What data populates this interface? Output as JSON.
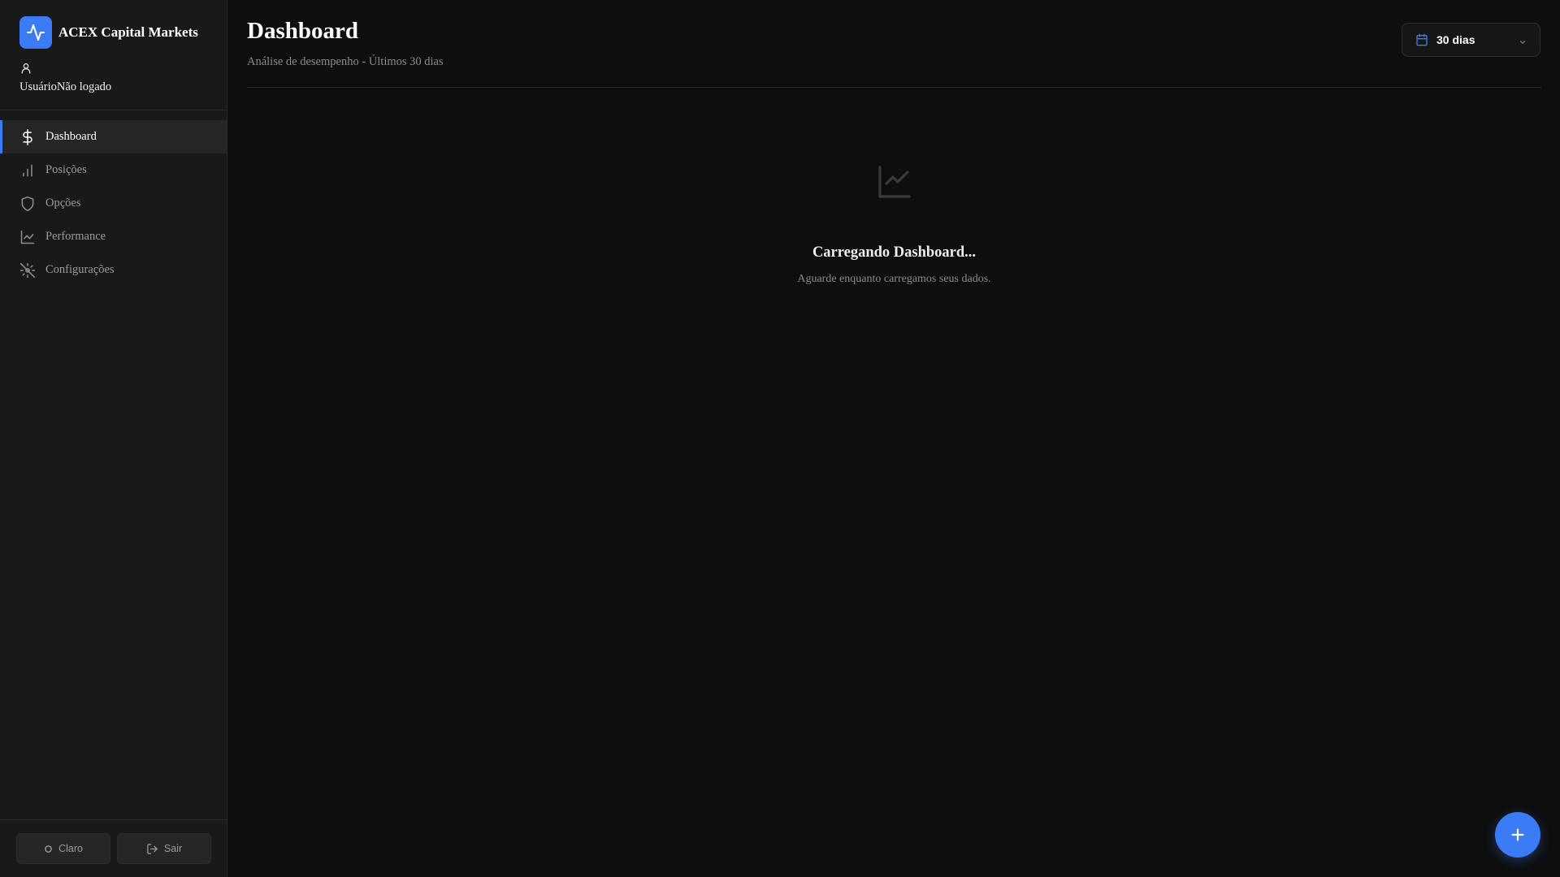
{
  "brand": {
    "name": "ACEX Capital Markets",
    "logo_icon": "activity-icon"
  },
  "user": {
    "label": "Usuário",
    "status": "Não logado",
    "icon": "user-icon"
  },
  "sidebar": {
    "items": [
      {
        "label": "Dashboard",
        "icon": "dollar-icon",
        "active": true
      },
      {
        "label": "Posições",
        "icon": "bar-chart-icon",
        "active": false
      },
      {
        "label": "Opções",
        "icon": "shield-icon",
        "active": false
      },
      {
        "label": "Performance",
        "icon": "line-chart-icon",
        "active": false
      },
      {
        "label": "Configurações",
        "icon": "settings-off-icon",
        "active": false
      }
    ],
    "theme_button": "Claro",
    "logout_button": "Sair"
  },
  "header": {
    "title": "Dashboard",
    "subtitle": "Análise de desempenho - Últimos 30 dias"
  },
  "range_select": {
    "value": "30 dias"
  },
  "loading": {
    "title": "Carregando Dashboard...",
    "subtitle": "Aguarde enquanto carregamos seus dados."
  },
  "colors": {
    "accent": "#3b7cf6",
    "background": "#0e0e0e",
    "sidebar": "#191919"
  }
}
